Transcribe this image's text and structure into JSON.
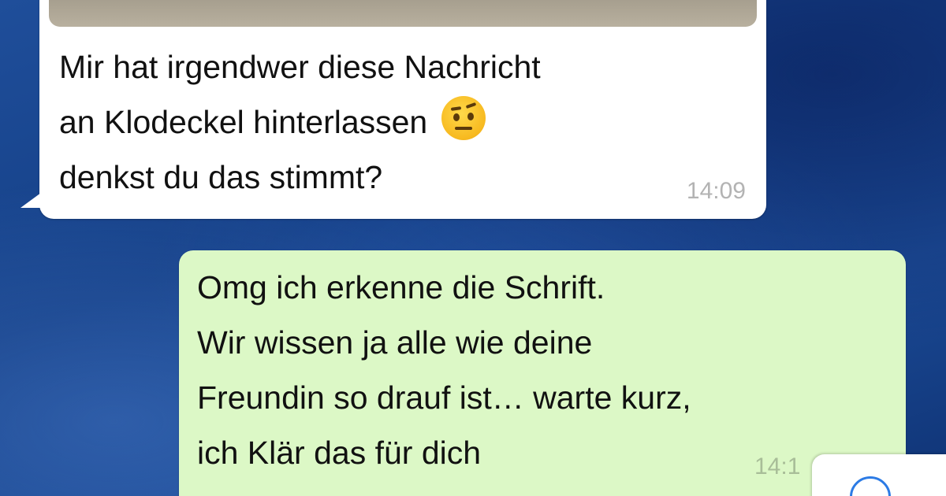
{
  "messages": [
    {
      "direction": "incoming",
      "lines": {
        "line1": "Mir hat irgendwer diese Nachricht",
        "line2": "an Klodeckel hinterlassen",
        "line3": "denkst du das stimmt?"
      },
      "emoji": "face-with-raised-eyebrow",
      "time": "14:09"
    },
    {
      "direction": "outgoing",
      "text": "Omg ich erkenne die Schrift.\nWir wissen ja alle wie deine\nFreundin so drauf ist… warte kurz,\nich Klär das für dich",
      "time": "14:1"
    }
  ],
  "colors": {
    "incoming_bubble": "#ffffff",
    "outgoing_bubble": "#dcf8c6",
    "timestamp": "#b3b3b3",
    "background": "#1b4a95",
    "accent": "#2c7be5"
  }
}
